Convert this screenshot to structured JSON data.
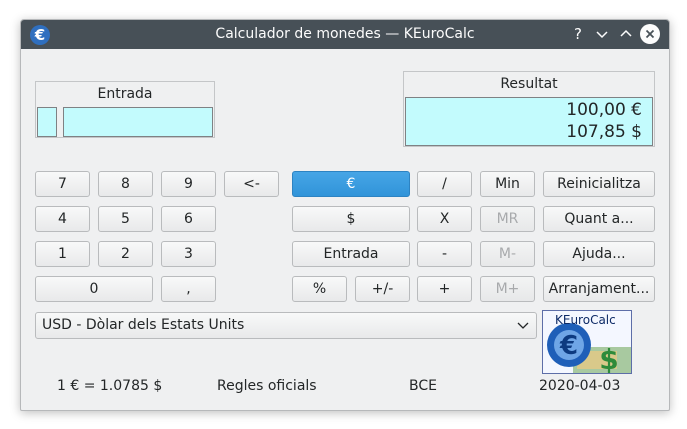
{
  "window": {
    "title": "Calculador de monedes — KEuroCalc",
    "help_glyph": "?",
    "minimize_glyph": "⌄",
    "maximize_glyph": "⌃",
    "close_glyph": "✕"
  },
  "input": {
    "label": "Entrada",
    "value": ""
  },
  "result": {
    "label": "Resultat",
    "line1": "100,00 €",
    "line2": "107,85 $"
  },
  "keypad": {
    "k7": "7",
    "k8": "8",
    "k9": "9",
    "back": "<-",
    "k4": "4",
    "k5": "5",
    "k6": "6",
    "k1": "1",
    "k2": "2",
    "k3": "3",
    "k0": "0",
    "comma": ","
  },
  "ops": {
    "euro": "€",
    "dollar": "$",
    "entry": "Entrada",
    "percent": "%",
    "plusminus": "+/-",
    "divide": "/",
    "multiply": "X",
    "minus": "-",
    "plus": "+",
    "min": "Min",
    "mr": "MR",
    "mminus": "M-",
    "mplus": "M+"
  },
  "actions": {
    "reset": "Reinicialitza",
    "about": "Quant a...",
    "help": "Ajuda...",
    "settings": "Arranjament..."
  },
  "currency_select": {
    "selected": "USD - Dòlar dels Estats Units"
  },
  "logo": {
    "text": "KEuroCalc"
  },
  "status": {
    "rate": "1 € = 1.0785 $",
    "rules": "Regles oficials",
    "source": "BCE",
    "date": "2020-04-03"
  }
}
